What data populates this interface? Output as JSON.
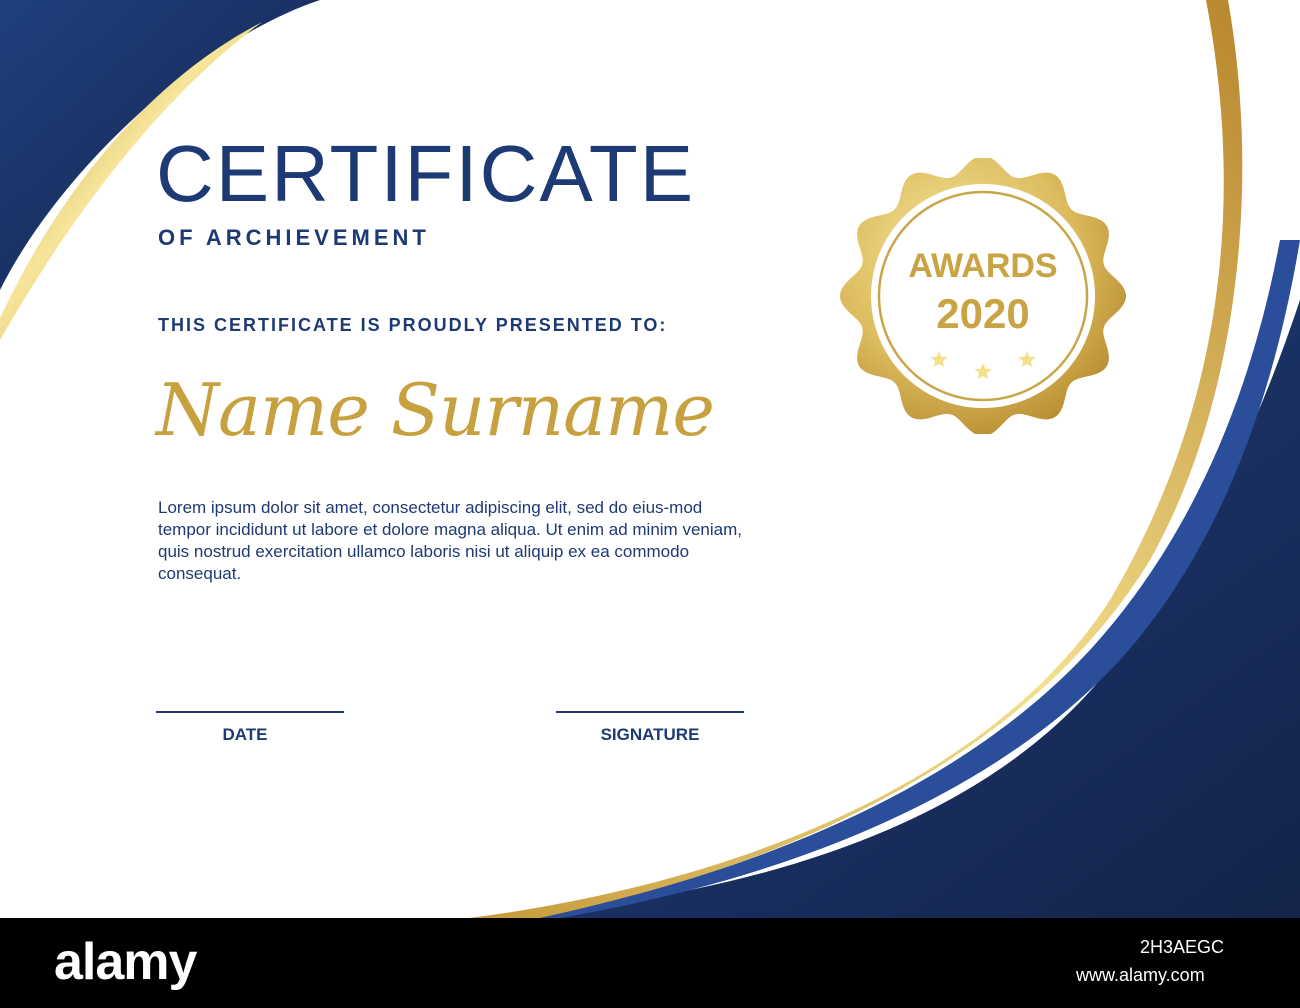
{
  "certificate": {
    "title": "CERTIFICATE",
    "subtitle": "OF ARCHIEVEMENT",
    "presented_to": "THIS CERTIFICATE IS PROUDLY PRESENTED TO:",
    "recipient_name": "Name Surname",
    "body": "Lorem ipsum dolor sit amet, consectetur adipiscing elit, sed do eius-mod tempor incididunt ut labore et dolore magna aliqua. Ut enim ad minim veniam, quis nostrud exercitation ullamco laboris nisi ut aliquip ex ea commodo consequat.",
    "date_label": "DATE",
    "signature_label": "SIGNATURE"
  },
  "seal": {
    "line1": "AWARDS",
    "line2": "2020",
    "stars": 3,
    "star_icon": "star-icon"
  },
  "stock_bar": {
    "logo": "alamy",
    "image_id": "2H3AEGC",
    "url": "www.alamy.com"
  },
  "colors": {
    "navy": "#1d3a74",
    "dark_navy": "#15254a",
    "gold": "#c9a444",
    "gold_light": "#f3e08a",
    "background": "#ffffff"
  }
}
